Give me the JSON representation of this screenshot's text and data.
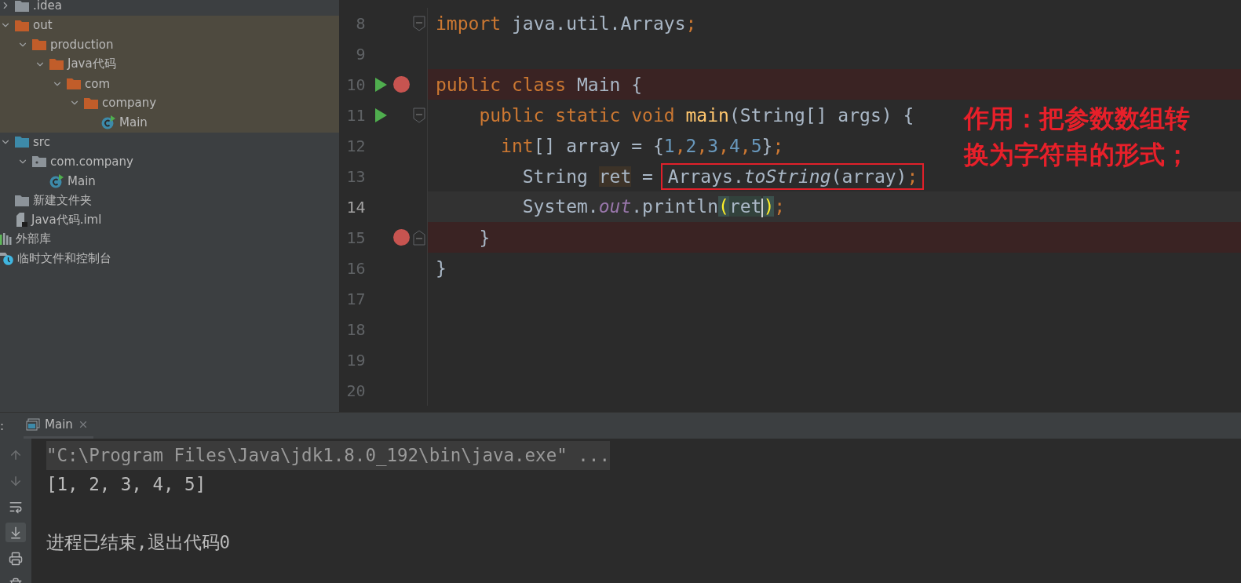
{
  "project_tree": [
    {
      "label": ".idea",
      "kind": "folder",
      "expanded": false,
      "highlighted": false
    },
    {
      "label": "out",
      "kind": "excluded-folder",
      "expanded": true,
      "highlighted": true,
      "children": [
        {
          "label": "production",
          "kind": "excluded-folder",
          "expanded": true,
          "highlighted": true,
          "children": [
            {
              "label": "Java代码",
              "kind": "excluded-folder",
              "expanded": true,
              "highlighted": true,
              "children": [
                {
                  "label": "com",
                  "kind": "excluded-folder",
                  "expanded": true,
                  "highlighted": true,
                  "children": [
                    {
                      "label": "company",
                      "kind": "excluded-folder",
                      "expanded": true,
                      "highlighted": true,
                      "children": [
                        {
                          "label": "Main",
                          "kind": "class",
                          "highlighted": true
                        }
                      ]
                    }
                  ]
                }
              ]
            }
          ]
        }
      ]
    },
    {
      "label": "src",
      "kind": "source-folder",
      "expanded": true,
      "highlighted": false,
      "children": [
        {
          "label": "com.company",
          "kind": "package",
          "expanded": true,
          "highlighted": false,
          "children": [
            {
              "label": "Main",
              "kind": "class",
              "highlighted": false
            }
          ]
        }
      ]
    },
    {
      "label": "新建文件夹",
      "kind": "folder",
      "highlighted": false
    },
    {
      "label": "Java代码.iml",
      "kind": "file",
      "highlighted": false
    },
    {
      "label": "外部库",
      "kind": "library",
      "highlighted": false
    },
    {
      "label": "临时文件和控制台",
      "kind": "scratches",
      "highlighted": false
    }
  ],
  "editor": {
    "lines": [
      {
        "number": "8",
        "fold_start": true,
        "fold_end": false,
        "run": false,
        "breakpoint": false,
        "current": false,
        "tokens": [
          {
            "kind": "keyword",
            "text": "import"
          },
          {
            "kind": "plain",
            "text": " java.util.Arrays"
          },
          {
            "kind": "keyword",
            "text": ";"
          }
        ]
      },
      {
        "number": "9",
        "fold_start": false,
        "fold_end": false,
        "run": false,
        "breakpoint": false,
        "current": false
      },
      {
        "number": "10",
        "fold_start": false,
        "fold_end": false,
        "run": true,
        "breakpoint": true,
        "current": false,
        "tokens": [
          {
            "kind": "keyword",
            "text": "public class"
          },
          {
            "kind": "plain",
            "text": " Main {"
          }
        ]
      },
      {
        "number": "11",
        "fold_start": true,
        "fold_end": false,
        "run": true,
        "breakpoint": false,
        "current": false,
        "tokens": [
          {
            "kind": "keyword",
            "text": "    public static void "
          },
          {
            "kind": "method",
            "text": "main"
          },
          {
            "kind": "plain",
            "text": "(String[] args) {"
          }
        ]
      },
      {
        "number": "12",
        "fold_start": false,
        "fold_end": false,
        "run": false,
        "breakpoint": false,
        "current": false,
        "tokens": [
          {
            "kind": "keyword",
            "text": "      int"
          },
          {
            "kind": "plain",
            "text": "[] array = {"
          },
          {
            "kind": "number",
            "text": "1"
          },
          {
            "kind": "keyword",
            "text": ","
          },
          {
            "kind": "number",
            "text": "2"
          },
          {
            "kind": "keyword",
            "text": ","
          },
          {
            "kind": "number",
            "text": "3"
          },
          {
            "kind": "keyword",
            "text": ","
          },
          {
            "kind": "number",
            "text": "4"
          },
          {
            "kind": "keyword",
            "text": ","
          },
          {
            "kind": "number",
            "text": "5"
          },
          {
            "kind": "plain",
            "text": "}"
          },
          {
            "kind": "keyword",
            "text": ";"
          }
        ]
      },
      {
        "number": "13",
        "fold_start": false,
        "fold_end": false,
        "run": false,
        "breakpoint": false,
        "current": false,
        "tokens": [
          {
            "kind": "plain",
            "text": "        String "
          },
          {
            "kind": "usage",
            "text": "ret"
          },
          {
            "kind": "plain",
            "text": " = "
          },
          {
            "kind": "boxed",
            "tokens": [
              {
                "kind": "plain",
                "text": "Arrays."
              },
              {
                "kind": "italic",
                "text": "toString"
              },
              {
                "kind": "plain",
                "text": "(array)"
              },
              {
                "kind": "keyword",
                "text": ";"
              }
            ]
          }
        ]
      },
      {
        "number": "14",
        "fold_start": false,
        "fold_end": false,
        "run": false,
        "breakpoint": false,
        "current": true,
        "tokens": [
          {
            "kind": "plain",
            "text": "        System."
          },
          {
            "kind": "field",
            "text": "out"
          },
          {
            "kind": "plain",
            "text": ".println"
          },
          {
            "kind": "brace-match",
            "text": "("
          },
          {
            "kind": "match-inner",
            "text": "ret",
            "caret_after": true
          },
          {
            "kind": "brace-match",
            "text": ")"
          },
          {
            "kind": "keyword",
            "text": ";"
          }
        ]
      },
      {
        "number": "15",
        "fold_start": false,
        "fold_end": true,
        "run": false,
        "breakpoint": true,
        "current": false,
        "tokens": [
          {
            "kind": "plain",
            "text": "    }"
          }
        ]
      },
      {
        "number": "16",
        "fold_start": false,
        "fold_end": false,
        "run": false,
        "breakpoint": false,
        "current": false,
        "tokens": [
          {
            "kind": "plain",
            "text": "}"
          }
        ]
      },
      {
        "number": "17",
        "fold_start": false,
        "fold_end": false,
        "run": false,
        "breakpoint": false,
        "current": false
      },
      {
        "number": "18",
        "fold_start": false,
        "fold_end": false,
        "run": false,
        "breakpoint": false,
        "current": false
      },
      {
        "number": "19",
        "fold_start": false,
        "fold_end": false,
        "run": false,
        "breakpoint": false,
        "current": false
      },
      {
        "number": "20",
        "fold_start": false,
        "fold_end": false,
        "run": false,
        "breakpoint": false,
        "current": false
      }
    ],
    "annotation": "作用：把参数数组转换为字符串的形式；"
  },
  "run_panel": {
    "label": ":",
    "tabs": [
      {
        "label": "Main",
        "selected": true
      }
    ],
    "toolbar": [
      {
        "kind": "up",
        "on": false
      },
      {
        "kind": "down",
        "on": false
      },
      {
        "kind": "wrap",
        "on": false
      },
      {
        "kind": "scroll-end",
        "on": true
      },
      {
        "kind": "print",
        "on": false
      },
      {
        "kind": "trash",
        "on": false
      }
    ],
    "console": [
      {
        "kind": "command",
        "text": "\"C:\\Program Files\\Java\\jdk1.8.0_192\\bin\\java.exe\" ..."
      },
      {
        "kind": "output",
        "text": "[1, 2, 3, 4, 5]"
      },
      {
        "kind": "exit",
        "text": "进程已结束,退出代码0"
      }
    ]
  }
}
